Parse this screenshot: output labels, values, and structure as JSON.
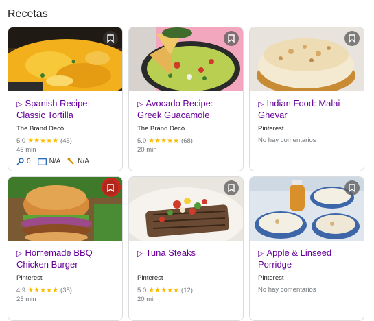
{
  "section": {
    "title": "Recetas"
  },
  "cards": [
    {
      "title": "Spanish Recipe: Classic Tortilla",
      "source": "The Brand Decō",
      "rating": "5.0",
      "stars": "★★★★★",
      "reviews": "(45)",
      "time": "45 min",
      "nutrition": {
        "a": "0",
        "b": "N/A",
        "c": "N/A"
      }
    },
    {
      "title": "Avocado Recipe: Greek Guacamole",
      "source": "The Brand Decō",
      "rating": "5.0",
      "stars": "★★★★★",
      "reviews": "(68)",
      "time": "20 min"
    },
    {
      "title": "Indian Food: Malai Ghevar",
      "source": "Pinterest",
      "comments": "No hay comentarios"
    },
    {
      "title": "Homemade BBQ Chicken Burger",
      "source": "Pinterest",
      "rating": "4.9",
      "stars": "★★★★★",
      "reviews": "(35)",
      "time": "25 min"
    },
    {
      "title": "Tuna Steaks",
      "source": "Pinterest",
      "rating": "5.0",
      "stars": "★★★★★",
      "reviews": "(12)",
      "time": "20 min"
    },
    {
      "title": "Apple & Linseed Porridge",
      "source": "Pinterest",
      "comments": "No hay comentarios"
    }
  ],
  "colors": {
    "title_link": "#660099",
    "star": "#fbbc04",
    "border": "#dadce0"
  }
}
